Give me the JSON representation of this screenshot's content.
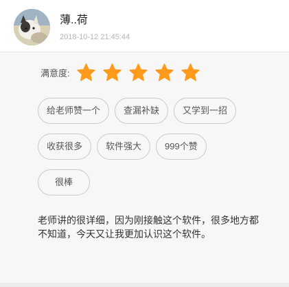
{
  "user": {
    "name": "薄..荷",
    "time": "2018-10-12 21:45:44",
    "avatar": "cat-photo-avatar"
  },
  "rating": {
    "label": "满意度:",
    "value": 5,
    "max": 5,
    "star_color": "#ff9a1a",
    "icon": "star-icon"
  },
  "tags": [
    "给老师赞一个",
    "查漏补缺",
    "又学到一招",
    "收获很多",
    "软件强大",
    "999个赞",
    "很棒"
  ],
  "comment": "老师讲的很详细，因为刚接触这个软件，很多地方都不知道，今天又让我更加认识这个软件。"
}
